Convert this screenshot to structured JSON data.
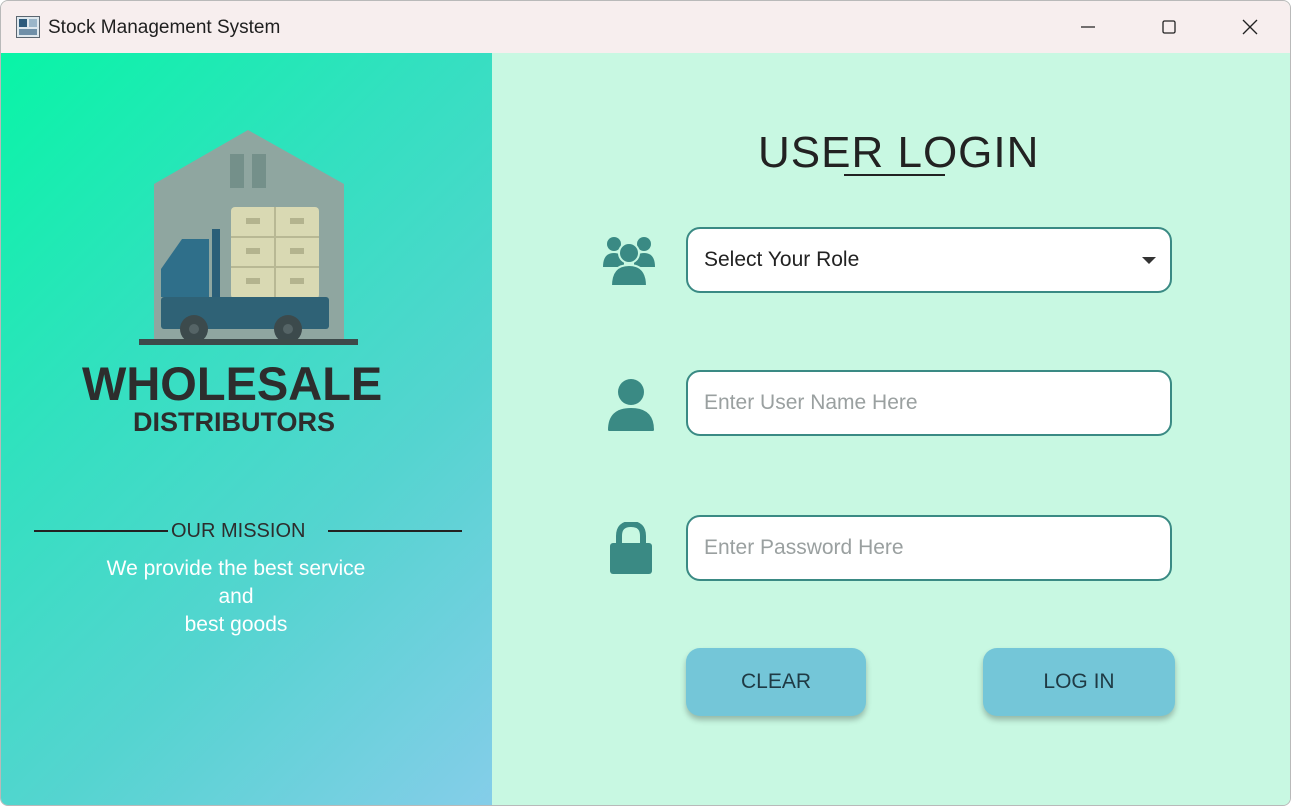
{
  "window": {
    "title": "Stock Management System",
    "icon": "app-window-icon",
    "controls": [
      "minimize-icon",
      "maximize-icon",
      "close-icon"
    ]
  },
  "brand": {
    "title": "WHOLESALE",
    "subtitle": "DISTRIBUTORS",
    "illustration": "warehouse-truck-illustration"
  },
  "mission": {
    "label": "OUR MISSION",
    "lines": [
      "We provide the best service",
      "and",
      "best goods"
    ]
  },
  "login": {
    "title": "USER LOGIN",
    "role_select": {
      "value": "Select Your Role",
      "icon": "users-group-icon"
    },
    "username": {
      "placeholder": "Enter User Name Here",
      "icon": "user-icon"
    },
    "password": {
      "placeholder": "Enter Password Here",
      "icon": "lock-icon"
    },
    "clear_label": "CLEAR",
    "login_label": "LOG IN"
  },
  "colors": {
    "accent": "#3a8a84",
    "button": "#74c6d8",
    "right_bg": "#c8f8e2",
    "left_gradient_start": "#08f5a6",
    "left_gradient_end": "#85cde9"
  }
}
